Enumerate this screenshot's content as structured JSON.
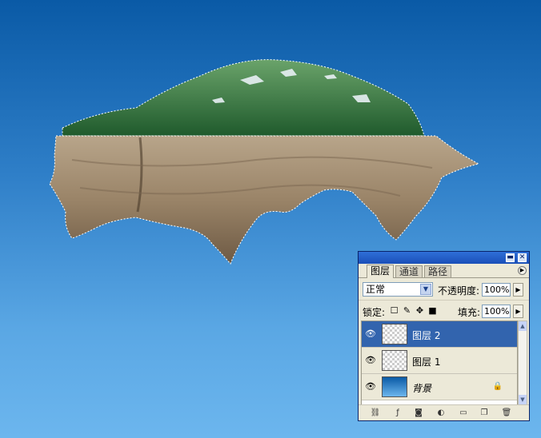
{
  "colors": {
    "sky_top": "#0a5aa6",
    "sky_bottom": "#6cb6ee",
    "selection": "#3264ae"
  },
  "panel": {
    "tabs": [
      "图层",
      "通道",
      "路径"
    ],
    "blend_mode": "正常",
    "opacity_label": "不透明度:",
    "opacity_value": "100%",
    "lock_label": "锁定:",
    "fill_label": "填充:",
    "fill_value": "100%",
    "layers": [
      {
        "name": "图层 2",
        "selected": true
      },
      {
        "name": "图层 1",
        "selected": false
      },
      {
        "name": "背景",
        "selected": false,
        "locked": true
      }
    ],
    "icons": [
      "link-icon",
      "layer-style-icon",
      "mask-icon",
      "adjustment-icon",
      "folder-icon",
      "new-layer-icon",
      "trash-icon"
    ]
  }
}
